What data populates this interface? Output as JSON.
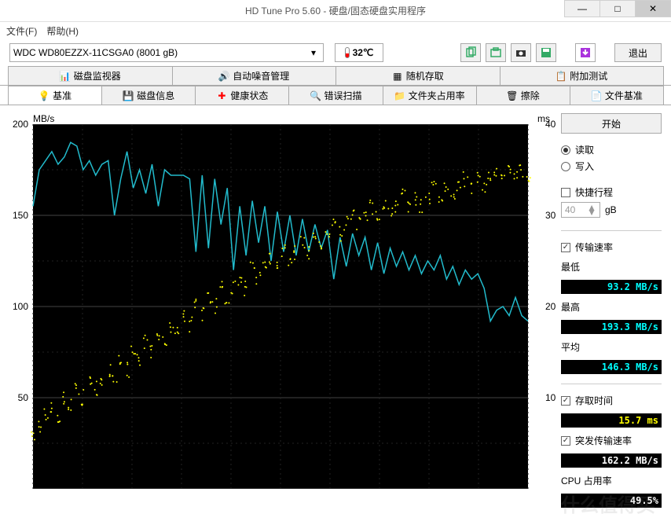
{
  "window": {
    "title": "HD Tune Pro 5.60 - 硬盘/固态硬盘实用程序",
    "min": "—",
    "max": "□",
    "close": "✕"
  },
  "menu": {
    "file": "文件(F)",
    "help": "帮助(H)"
  },
  "toolbar": {
    "drive": "WDC WD80EZZX-11CSGA0 (8001 gB)",
    "temp": "32℃",
    "exit": "退出"
  },
  "tabs_upper": [
    {
      "label": "磁盘监视器"
    },
    {
      "label": "自动噪音管理"
    },
    {
      "label": "随机存取"
    },
    {
      "label": "附加测试"
    }
  ],
  "tabs_lower": [
    {
      "label": "基准"
    },
    {
      "label": "磁盘信息"
    },
    {
      "label": "健康状态"
    },
    {
      "label": "错误扫描"
    },
    {
      "label": "文件夹占用率"
    },
    {
      "label": "擦除"
    },
    {
      "label": "文件基准"
    }
  ],
  "chart": {
    "ylabel_left": "MB/s",
    "ylabel_right": "ms",
    "y_left": {
      "t200": "200",
      "t150": "150",
      "t100": "100",
      "t50": "50"
    },
    "y_right": {
      "t40": "40",
      "t30": "30",
      "t20": "20",
      "t10": "10"
    }
  },
  "chart_data": {
    "type": "line",
    "title": "",
    "xlabel": "",
    "ylabel_left": "MB/s",
    "ylabel_right": "ms",
    "ylim_left": [
      0,
      200
    ],
    "ylim_right": [
      0,
      40
    ],
    "series": [
      {
        "name": "Transfer rate (MB/s)",
        "axis": "left",
        "values": [
          155,
          175,
          180,
          185,
          178,
          182,
          190,
          188,
          175,
          180,
          172,
          178,
          180,
          150,
          170,
          185,
          165,
          175,
          162,
          178,
          155,
          175,
          172,
          172,
          172,
          170,
          130,
          172,
          132,
          170,
          145,
          165,
          120,
          155,
          128,
          158,
          135,
          155,
          125,
          152,
          130,
          150,
          128,
          148,
          130,
          145,
          132,
          142,
          115,
          138,
          122,
          140,
          128,
          138,
          120,
          135,
          118,
          132,
          122,
          130,
          120,
          128,
          118,
          125,
          120,
          128,
          115,
          122,
          112,
          120,
          115,
          118,
          110,
          92,
          98,
          100,
          95,
          105,
          95,
          92
        ]
      },
      {
        "name": "Access time (ms)",
        "axis": "right",
        "type": "scatter",
        "values": [
          6,
          7,
          8,
          9,
          8,
          10,
          9,
          11,
          10,
          12,
          11,
          12,
          13,
          12,
          14,
          13,
          15,
          14,
          16,
          15,
          17,
          16,
          18,
          17,
          19,
          18,
          20,
          19,
          21,
          20,
          22,
          21,
          22,
          23,
          22,
          24,
          23,
          24,
          25,
          24,
          26,
          25,
          26,
          27,
          26,
          28,
          27,
          28,
          29,
          28,
          29,
          30,
          29,
          30,
          31,
          30,
          31,
          30,
          31,
          32,
          31,
          32,
          31,
          32,
          33,
          32,
          33,
          32,
          33,
          34,
          33,
          34,
          33,
          34,
          35,
          34,
          35,
          34,
          35,
          34
        ]
      }
    ]
  },
  "side": {
    "start": "开始",
    "read": "读取",
    "write": "写入",
    "shortstroke": "快捷行程",
    "stroke_val": "40",
    "stroke_unit": "gB",
    "transfer": "传输速率",
    "min_label": "最低",
    "min_val": "93.2 MB/s",
    "max_label": "最高",
    "max_val": "193.3 MB/s",
    "avg_label": "平均",
    "avg_val": "146.3 MB/s",
    "access": "存取时间",
    "access_val": "15.7 ms",
    "burst": "突发传输速率",
    "burst_val": "162.2 MB/s",
    "cpu": "CPU 占用率",
    "cpu_val": "49.5%"
  },
  "watermark": "什么值得买"
}
